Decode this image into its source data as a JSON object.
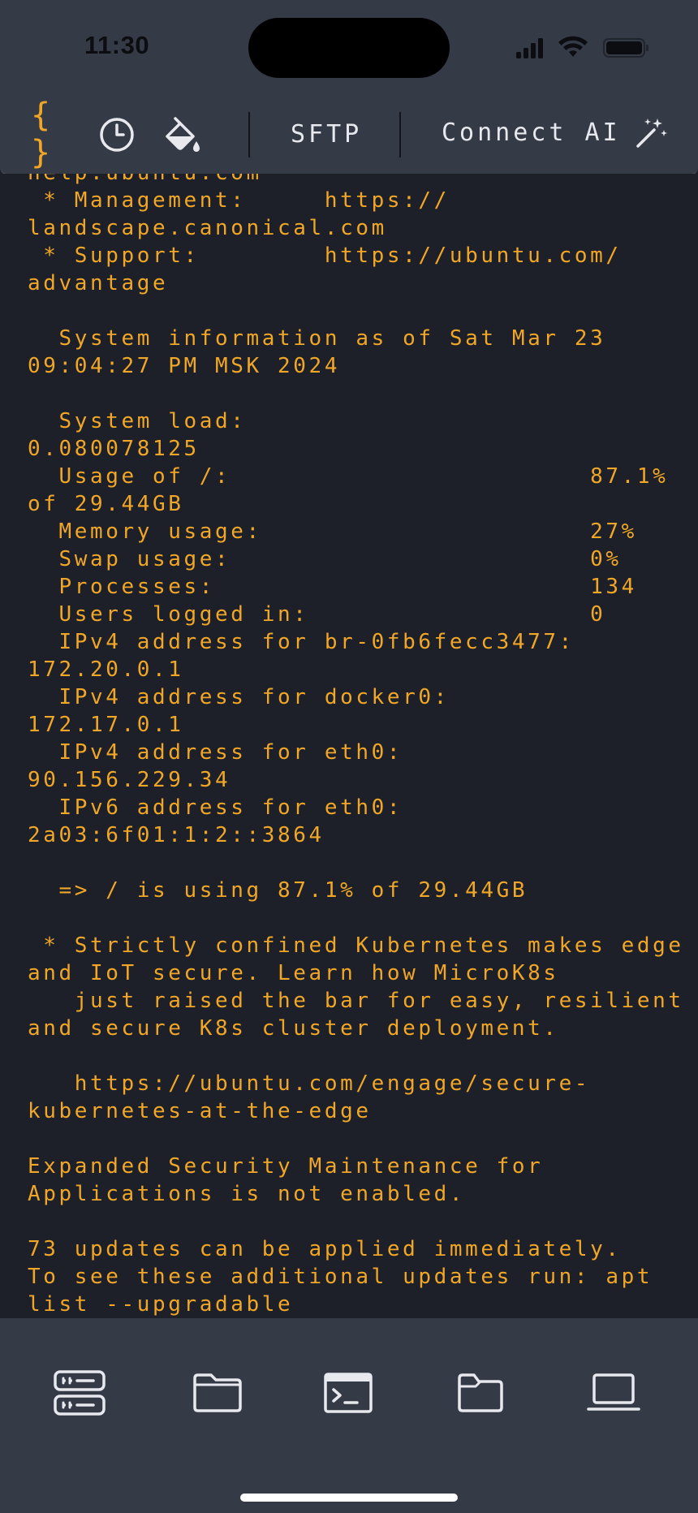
{
  "status_bar": {
    "time": "11:30",
    "icons": [
      "signal-icon",
      "wifi-icon",
      "battery-icon"
    ]
  },
  "toolbar": {
    "snippets_icon": "{ }",
    "sftp_label": "SFTP",
    "connect_ai_label": "Connect AI",
    "icons": [
      "braces-icon",
      "history-clock-icon",
      "paint-bucket-icon",
      "magic-wand-icon"
    ],
    "accent_color": "#f0a626"
  },
  "terminal": {
    "text_color": "#f0a626",
    "background": "#1d2029",
    "lines": [
      "help.ubuntu.com",
      " * Management:     https://",
      "landscape.canonical.com",
      " * Support:        https://ubuntu.com/",
      "advantage",
      "",
      "  System information as of Sat Mar 23",
      "09:04:27 PM MSK 2024",
      "",
      "  System load:",
      "0.080078125",
      "  Usage of /:                       87.1%",
      "of 29.44GB",
      "  Memory usage:                     27%",
      "  Swap usage:                       0%",
      "  Processes:                        134",
      "  Users logged in:                  0",
      "  IPv4 address for br-0fb6fecc3477:",
      "172.20.0.1",
      "  IPv4 address for docker0:",
      "172.17.0.1",
      "  IPv4 address for eth0:",
      "90.156.229.34",
      "  IPv6 address for eth0:",
      "2a03:6f01:1:2::3864",
      "",
      "  => / is using 87.1% of 29.44GB",
      "",
      " * Strictly confined Kubernetes makes edge",
      "and IoT secure. Learn how MicroK8s",
      "   just raised the bar for easy, resilient",
      "and secure K8s cluster deployment.",
      "",
      "   https://ubuntu.com/engage/secure-",
      "kubernetes-at-the-edge",
      "",
      "Expanded Security Maintenance for",
      "Applications is not enabled.",
      "",
      "73 updates can be applied immediately.",
      "To see these additional updates run: apt",
      "list --upgradable"
    ]
  },
  "bottom_nav": {
    "items": [
      "hosts-server-icon",
      "files-folder-icon",
      "terminal-icon",
      "sftp-folder-icon",
      "local-laptop-icon"
    ]
  }
}
